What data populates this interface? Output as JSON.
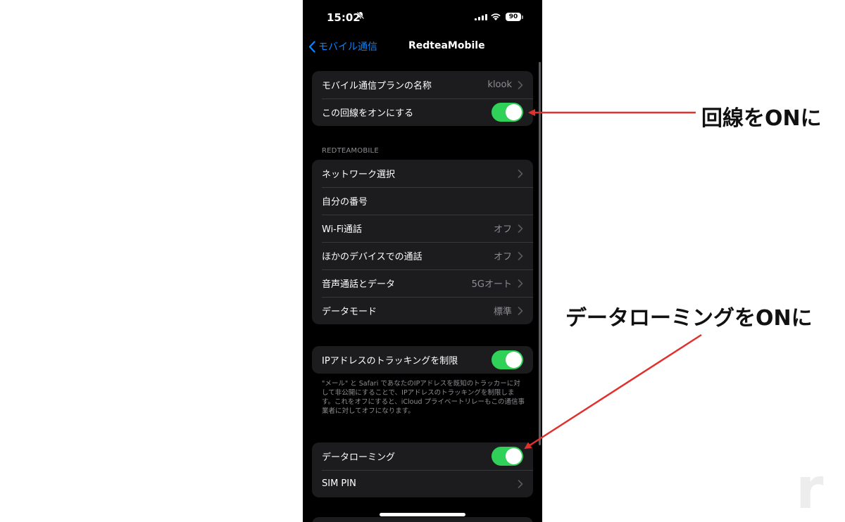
{
  "status_bar": {
    "time": "15:02",
    "battery": "90"
  },
  "nav": {
    "back_label": "モバイル通信",
    "title": "RedteaMobile"
  },
  "group1": {
    "rows": [
      {
        "label": "モバイル通信プランの名称",
        "value": "klook"
      },
      {
        "label": "この回線をオンにする",
        "toggle": true
      }
    ]
  },
  "section_header": "REDTEAMOBILE",
  "group2": {
    "rows": [
      {
        "label": "ネットワーク選択",
        "value": ""
      },
      {
        "label": "自分の番号",
        "value": ""
      },
      {
        "label": "Wi-Fi通話",
        "value": "オフ"
      },
      {
        "label": "ほかのデバイスでの通話",
        "value": "オフ"
      },
      {
        "label": "音声通話とデータ",
        "value": "5Gオート"
      },
      {
        "label": "データモード",
        "value": "標準"
      }
    ]
  },
  "group3": {
    "rows": [
      {
        "label": "IPアドレスのトラッキングを制限",
        "toggle": true
      }
    ],
    "footer": "\"メール\" と Safari であなたのIPアドレスを既知のトラッカーに対して非公開にすることで、IPアドレスのトラッキングを制限します。これをオフにすると、iCloud プライベートリレーもこの通信事業者に対してオフになります。"
  },
  "group4": {
    "rows": [
      {
        "label": "データローミング",
        "toggle": true
      },
      {
        "label": "SIM PIN",
        "value": ""
      }
    ]
  },
  "annotations": {
    "line_on": "回線をONに",
    "roaming_on": "データローミングをONに"
  },
  "watermark": "r",
  "colors": {
    "accent": "#0a84ff",
    "toggle_on": "#30d158",
    "arrow": "#e0312d"
  }
}
